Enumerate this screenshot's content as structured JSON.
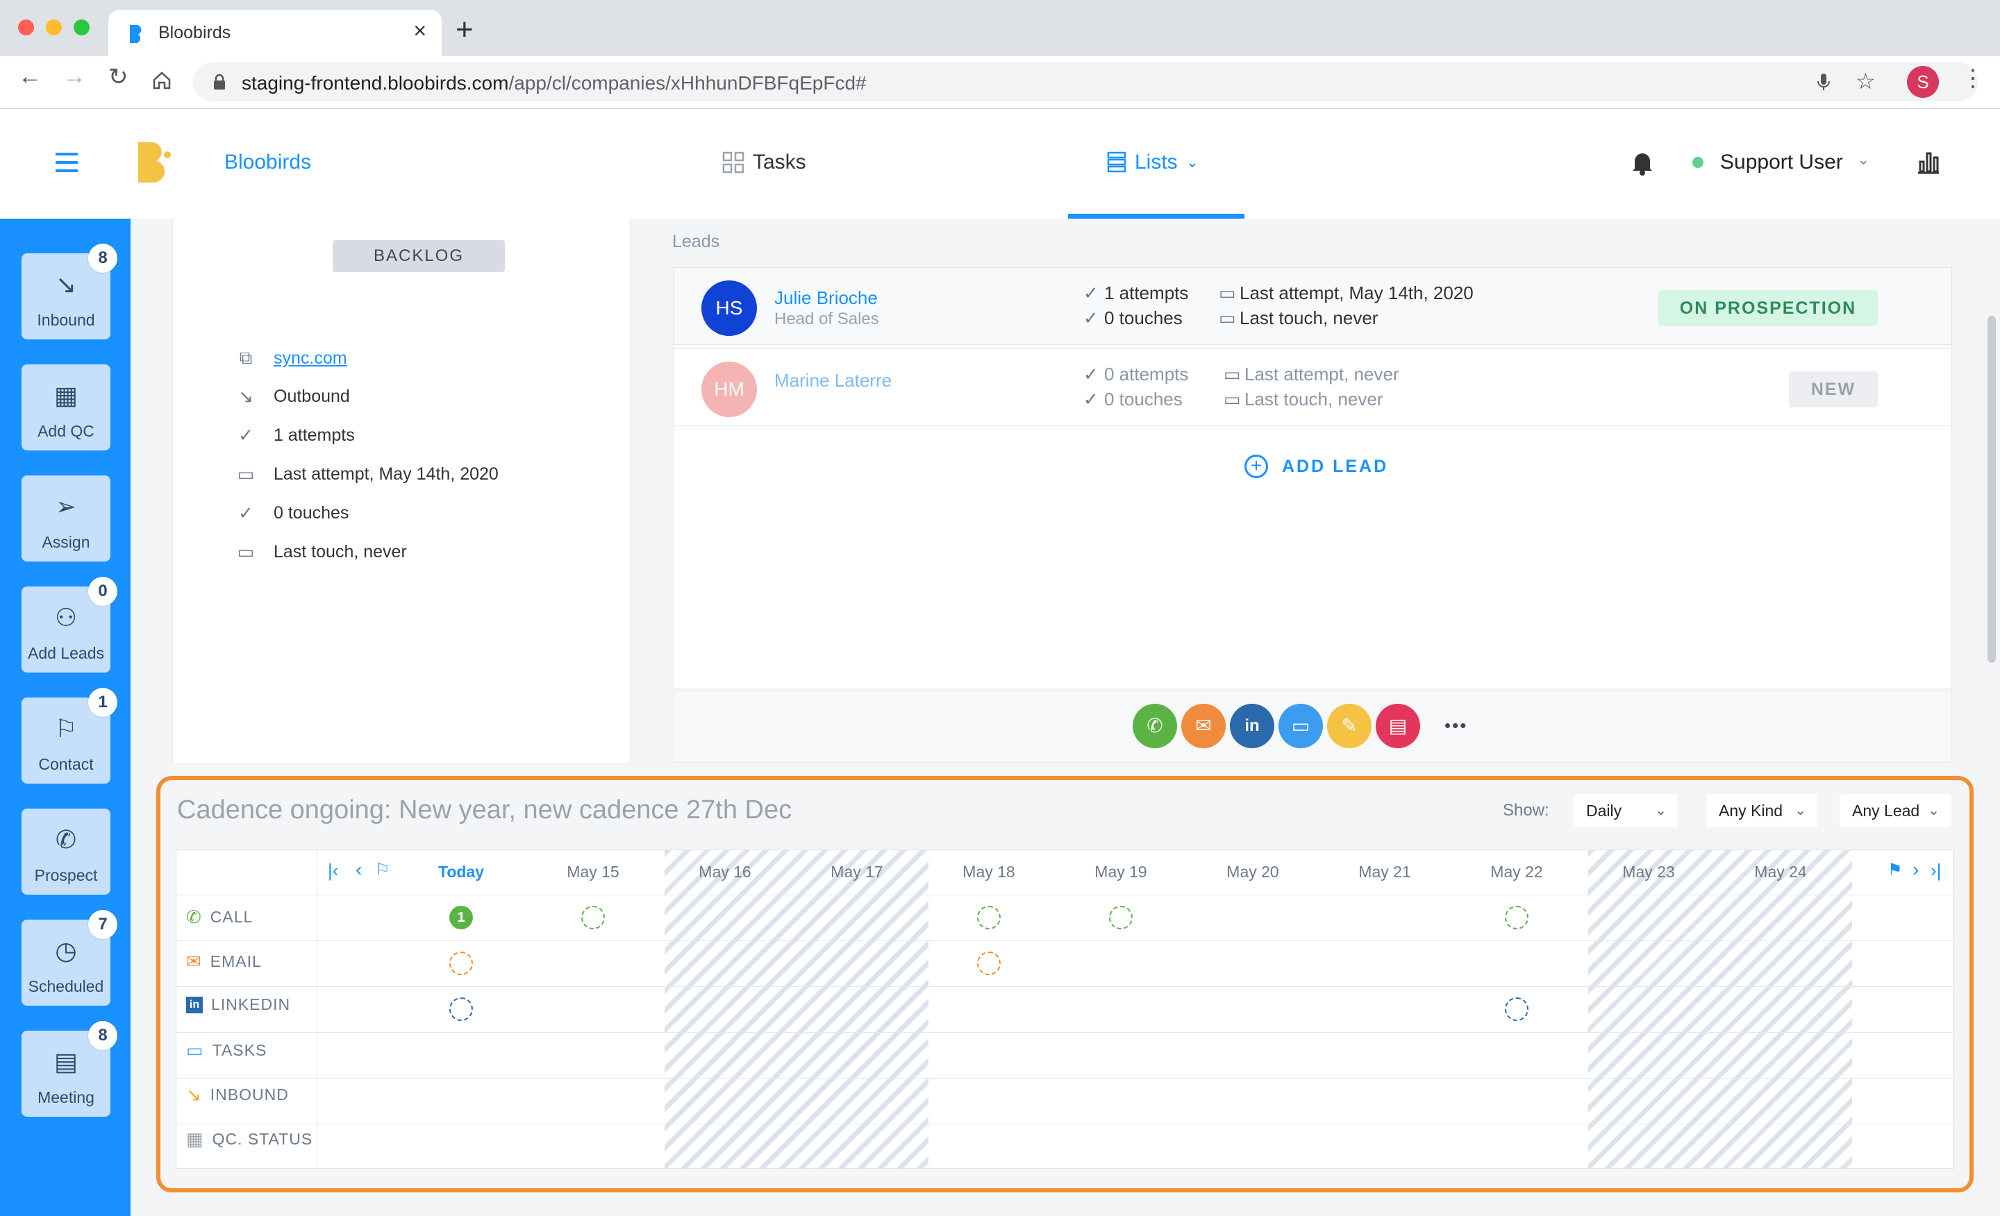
{
  "browser": {
    "tab_title": "Bloobirds",
    "url_host": "staging-frontend.bloobirds.com",
    "url_path": "/app/cl/companies/xHhhunDFBFqEpFcd#",
    "profile_initial": "S"
  },
  "header": {
    "brand": "Bloobirds",
    "nav_tasks": "Tasks",
    "nav_lists": "Lists",
    "user_name": "Support User",
    "accent_color": "#1991ff"
  },
  "sidebar": {
    "items": [
      {
        "label": "Inbound",
        "badge": "8",
        "icon": "arrow-down-right-icon"
      },
      {
        "label": "Add QC",
        "badge": "",
        "icon": "building-icon"
      },
      {
        "label": "Assign",
        "badge": "",
        "icon": "send-icon"
      },
      {
        "label": "Add Leads",
        "badge": "0",
        "icon": "user-add-icon"
      },
      {
        "label": "Contact",
        "badge": "1",
        "icon": "flag-icon"
      },
      {
        "label": "Prospect",
        "badge": "",
        "icon": "phone-icon"
      },
      {
        "label": "Scheduled",
        "badge": "7",
        "icon": "clock-icon"
      },
      {
        "label": "Meeting",
        "badge": "8",
        "icon": "calendar-icon"
      }
    ]
  },
  "company": {
    "status": "BACKLOG",
    "website": "sync.com",
    "source": "Outbound",
    "attempts": "1 attempts",
    "last_attempt": "Last attempt, May 14th, 2020",
    "touches": "0 touches",
    "last_touch": "Last touch, never"
  },
  "leads": {
    "section_label": "Leads",
    "add_lead": "ADD LEAD",
    "items": [
      {
        "initials": "HS",
        "name": "Julie Brioche",
        "role": "Head of Sales",
        "attempts": "1 attempts",
        "touches": "0 touches",
        "last_attempt": "Last attempt, May 14th, 2020",
        "last_touch": "Last touch, never",
        "status": "ON PROSPECTION",
        "avatar_color": "#1042d6"
      },
      {
        "initials": "HM",
        "name": "Marine Laterre",
        "role": "",
        "attempts": "0 attempts",
        "touches": "0 touches",
        "last_attempt": "Last attempt, never",
        "last_touch": "Last touch, never",
        "status": "NEW",
        "avatar_color": "#f4b4b4"
      }
    ],
    "more": "•••"
  },
  "cadence": {
    "title": "Cadence ongoing: New year, new cadence 27th Dec",
    "show_label": "Show:",
    "filter_period": "Daily",
    "filter_kind": "Any Kind",
    "filter_lead": "Any Lead",
    "columns": [
      "Today",
      "May 15",
      "May 16",
      "May 17",
      "May 18",
      "May 19",
      "May 20",
      "May 21",
      "May 22",
      "May 23",
      "May 24"
    ],
    "rows": [
      "CALL",
      "EMAIL",
      "LINKEDIN",
      "TASKS",
      "INBOUND",
      "QC. STATUS"
    ],
    "today_count": "1",
    "frame_color": "#f28f31"
  }
}
